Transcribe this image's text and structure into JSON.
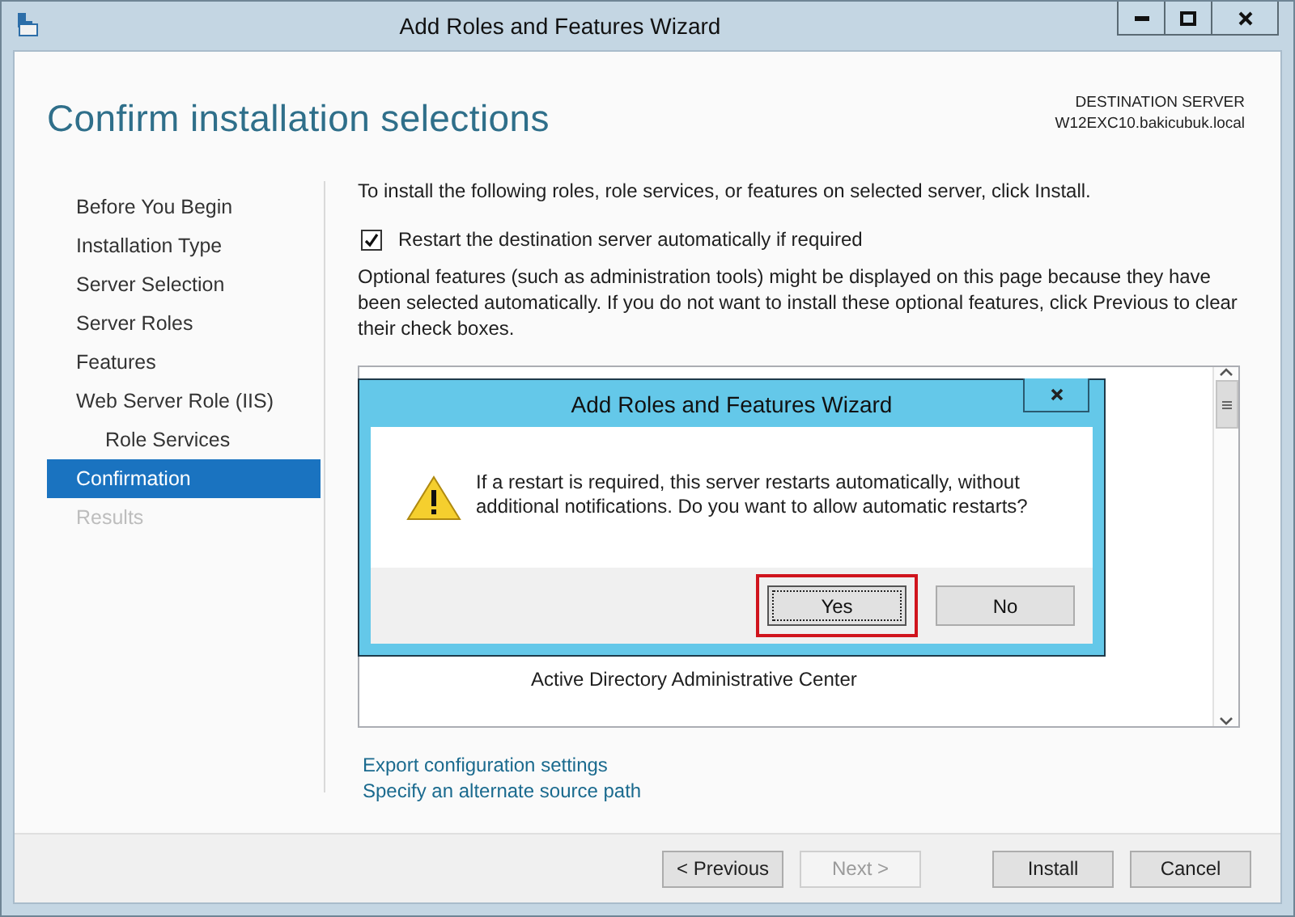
{
  "window": {
    "title": "Add Roles and Features Wizard"
  },
  "header": {
    "title": "Confirm installation selections",
    "destination_label": "DESTINATION SERVER",
    "destination_server": "W12EXC10.bakicubuk.local"
  },
  "nav": [
    {
      "label": "Before You Begin",
      "selected": false,
      "disabled": false
    },
    {
      "label": "Installation Type",
      "selected": false,
      "disabled": false
    },
    {
      "label": "Server Selection",
      "selected": false,
      "disabled": false
    },
    {
      "label": "Server Roles",
      "selected": false,
      "disabled": false
    },
    {
      "label": "Features",
      "selected": false,
      "disabled": false
    },
    {
      "label": "Web Server Role (IIS)",
      "selected": false,
      "disabled": false,
      "children": [
        {
          "label": "Role Services",
          "selected": false,
          "disabled": false
        }
      ]
    },
    {
      "label": "Confirmation",
      "selected": true,
      "disabled": false
    },
    {
      "label": "Results",
      "selected": false,
      "disabled": true
    }
  ],
  "content": {
    "intro": "To install the following roles, role services, or features on selected server, click Install.",
    "restart_checkbox": {
      "label": "Restart the destination server automatically if required",
      "checked": true
    },
    "note": "Optional features (such as administration tools) might be displayed on this page because they have been selected automatically. If you do not want to install these optional features, click Previous to clear their check boxes.",
    "list_items": [
      "Active Directory Administrative Center"
    ],
    "links": [
      "Export configuration settings",
      "Specify an alternate source path"
    ]
  },
  "buttons": [
    {
      "label": "< Previous",
      "disabled": false
    },
    {
      "label": "Next >",
      "disabled": true
    },
    {
      "label": "Install",
      "disabled": false
    },
    {
      "label": "Cancel",
      "disabled": false
    }
  ],
  "dialog": {
    "title": "Add Roles and Features Wizard",
    "message": "If a restart is required, this server restarts automatically, without additional notifications. Do you want to allow automatic restarts?",
    "buttons": [
      {
        "label": "Yes",
        "focused": true,
        "highlighted": true
      },
      {
        "label": "No",
        "focused": false,
        "highlighted": false
      }
    ]
  }
}
